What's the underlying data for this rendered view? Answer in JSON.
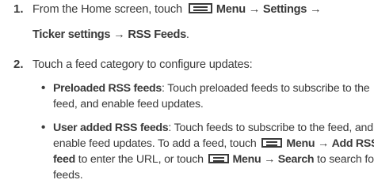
{
  "step1": {
    "number": "1.",
    "text_a": "From the Home screen, touch",
    "menu_label": "Menu",
    "arrow1": "→",
    "settings": "Settings",
    "arrow2": "→",
    "ticker_settings": "Ticker settings",
    "arrow3": "→",
    "rss_feeds": "RSS Feeds",
    "period": "."
  },
  "step2": {
    "number": "2.",
    "text": "Touch a feed category to configure updates:"
  },
  "bullet1": {
    "bullet": "•",
    "title": "Preloaded RSS feeds",
    "line1": ": Touch preloaded feeds to subscribe to the",
    "line2": "feed, and enable feed updates."
  },
  "bullet2": {
    "bullet": "•",
    "title": "User added RSS feeds",
    "line1": ": Touch feeds to subscribe to the feed, and",
    "line2": "enable feed updates. To add a feed, touch",
    "menu1": "Menu",
    "arrow_a": "→",
    "add_rss": "Add RSS",
    "feed_word": "feed",
    "line3_mid": " to enter the URL, or touch",
    "menu2": "Menu",
    "arrow_b": "→",
    "search": "Search",
    "line3_end": " to search for",
    "line4": "feeds."
  }
}
